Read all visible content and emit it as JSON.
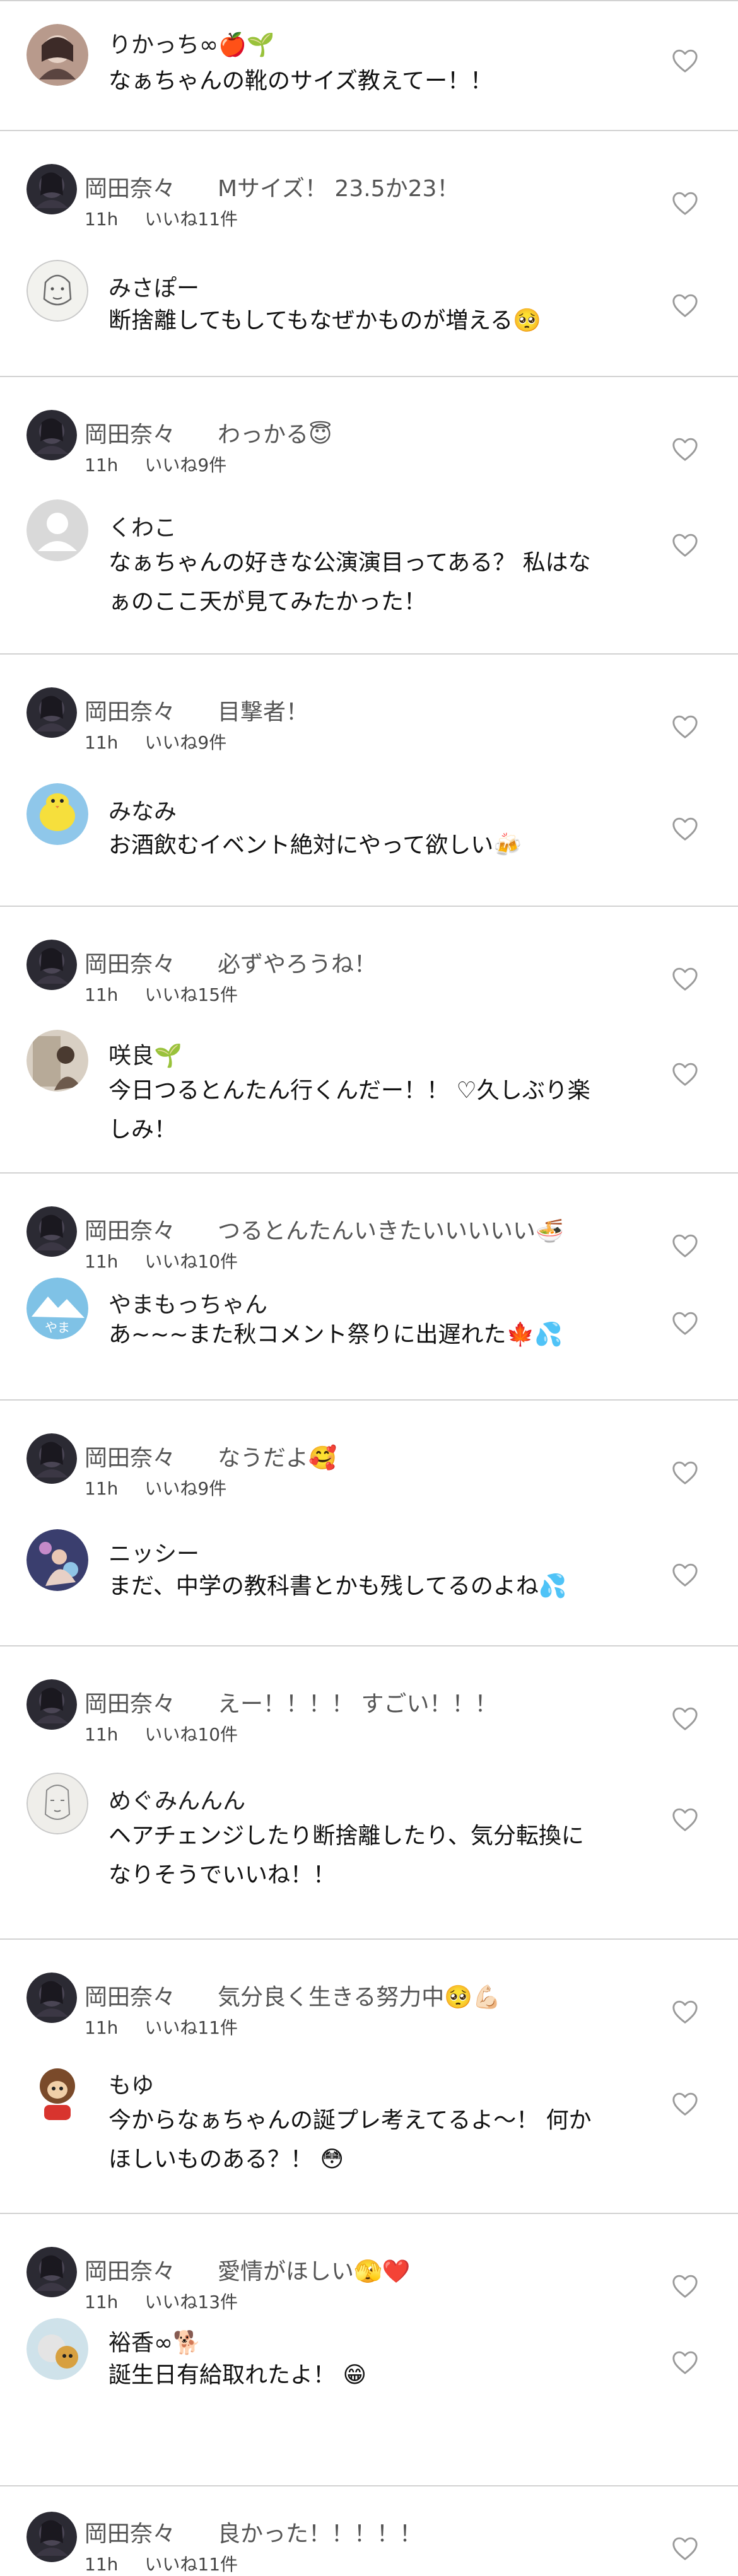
{
  "thread1": {
    "c1": {
      "name": "りかっち∞🍎🌱",
      "text": "なぁちゃんの靴のサイズ教えてー！！"
    }
  },
  "thread2": {
    "owner": {
      "name": "岡田奈々",
      "text": "Mサイズ！ 23.5か23！",
      "time": "11h",
      "likes": "いいね11件"
    },
    "c1": {
      "name": "みさぽー",
      "text": "断捨離してもしてもなぜかものが増える🥺"
    }
  },
  "thread3": {
    "owner": {
      "name": "岡田奈々",
      "text": "わっかる😇",
      "time": "11h",
      "likes": "いいね9件"
    },
    "c1": {
      "name": "くわこ",
      "text": "なぁちゃんの好きな公演演目ってある？ 私はな\nぁのここ天が見てみたかった！"
    }
  },
  "thread4": {
    "owner": {
      "name": "岡田奈々",
      "text": "目撃者！",
      "time": "11h",
      "likes": "いいね9件"
    },
    "c1": {
      "name": "みなみ",
      "text": "お酒飲むイベント絶対にやって欲しい🍻"
    }
  },
  "thread5": {
    "owner": {
      "name": "岡田奈々",
      "text": "必ずやろうね！",
      "time": "11h",
      "likes": "いいね15件"
    },
    "c1": {
      "name": "咲良🌱",
      "text": "今日つるとんたん行くんだー！！ ♡久しぶり楽\nしみ！"
    }
  },
  "thread6": {
    "owner": {
      "name": "岡田奈々",
      "text": "つるとんたんいきたいいいいい🍜",
      "time": "11h",
      "likes": "いいね10件"
    },
    "c1": {
      "name": "やまもっちゃん",
      "text": "あ~~~また秋コメント祭りに出遅れた🍁💦"
    }
  },
  "thread7": {
    "owner": {
      "name": "岡田奈々",
      "text": "なうだよ🥰",
      "time": "11h",
      "likes": "いいね9件"
    },
    "c1": {
      "name": "ニッシー",
      "text": "まだ、中学の教科書とかも残してるのよね💦"
    }
  },
  "thread8": {
    "owner": {
      "name": "岡田奈々",
      "text": "えー！！！！ すごい！！！",
      "time": "11h",
      "likes": "いいね10件"
    },
    "c1": {
      "name": "めぐみんんん",
      "text": "ヘアチェンジしたり断捨離したり、気分転換に\nなりそうでいいね！！"
    }
  },
  "thread9": {
    "owner": {
      "name": "岡田奈々",
      "text": "気分良く生きる努力中🥺💪🏻",
      "time": "11h",
      "likes": "いいね11件"
    },
    "c1": {
      "name": "もゆ",
      "text": "今からなぁちゃんの誕プレ考えてるよ～！ 何か\nほしいものある？！ 😳"
    }
  },
  "thread10": {
    "owner": {
      "name": "岡田奈々",
      "text": "愛情がほしい🫣❤️",
      "time": "11h",
      "likes": "いいね13件"
    },
    "c1": {
      "name": "裕香∞🐕",
      "text": "誕生日有給取れたよ！ 😁"
    }
  },
  "thread11": {
    "owner": {
      "name": "岡田奈々",
      "text": "良かった！！！！！",
      "time": "11h",
      "likes": "いいね11件"
    }
  },
  "colors": {
    "divider": "#d2d2d2",
    "heart_outline": "#9a9a9a",
    "owner_avatar": "#2b2a33"
  }
}
